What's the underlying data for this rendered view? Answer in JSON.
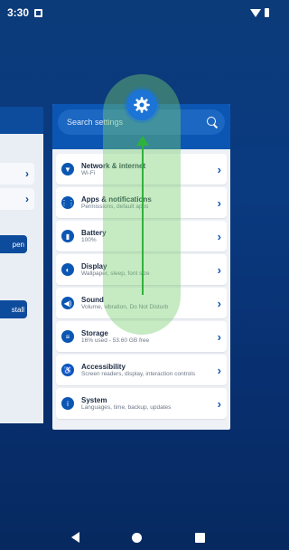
{
  "status": {
    "time": "3:30"
  },
  "search": {
    "placeholder": "Search settings"
  },
  "settings": [
    {
      "title": "Network & internet",
      "subtitle": "Wi-Fi",
      "icon": "wifi-icon",
      "glyph": "▼"
    },
    {
      "title": "Apps & notifications",
      "subtitle": "Permissions, default apps",
      "icon": "apps-icon",
      "glyph": "⋮⋮"
    },
    {
      "title": "Battery",
      "subtitle": "100%",
      "icon": "battery-icon",
      "glyph": "▮"
    },
    {
      "title": "Display",
      "subtitle": "Wallpaper, sleep, font size",
      "icon": "display-icon",
      "glyph": "◐"
    },
    {
      "title": "Sound",
      "subtitle": "Volume, vibration, Do Not Disturb",
      "icon": "volume-icon",
      "glyph": "◀)"
    },
    {
      "title": "Storage",
      "subtitle": "16% used - 53.60 GB free",
      "icon": "storage-icon",
      "glyph": "≡"
    },
    {
      "title": "Accessibility",
      "subtitle": "Screen readers, display, interaction controls",
      "icon": "accessibility-icon",
      "glyph": "♿"
    },
    {
      "title": "System",
      "subtitle": "Languages, time, backup, updates",
      "icon": "info-icon",
      "glyph": "i"
    }
  ],
  "left_card": {
    "open_label": "pen",
    "install_label": "stall"
  },
  "colors": {
    "accent": "#0b56b3",
    "gesture": "#2fb23d"
  }
}
